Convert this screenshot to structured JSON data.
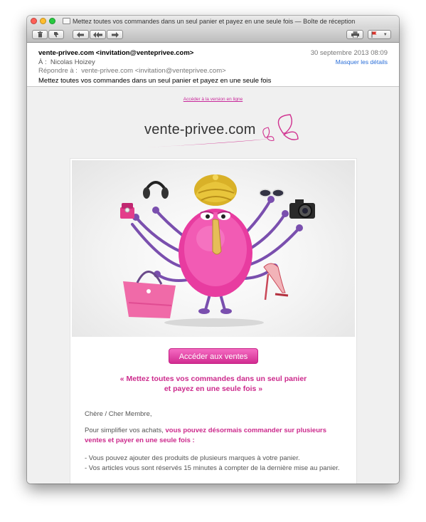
{
  "window": {
    "title": "Mettez toutes vos commandes dans un seul panier et payez en une seule fois — Boîte de réception"
  },
  "toolbar": {
    "buttons": [
      "trash-icon",
      "junk-icon",
      "reply-icon",
      "reply-all-icon",
      "forward-icon",
      "print-icon",
      "flag-icon"
    ]
  },
  "header": {
    "from": "vente-privee.com <invitation@venteprivee.com>",
    "date": "30 septembre 2013 08:09",
    "hide_details": "Masquer les détails",
    "to_label": "À :",
    "to_value": "Nicolas Hoizey",
    "reply_label": "Répondre à :",
    "reply_value": "vente-privee.com <invitation@venteprivee.com>",
    "subject": "Mettez toutes vos commandes dans un seul panier et payez en une seule fois"
  },
  "email": {
    "online_link": "Accéder à la version en ligne",
    "logo_text": "vente-privee.com",
    "cta": "Accéder aux ventes",
    "slogan_line1": "« Mettez toutes vos commandes dans un seul panier",
    "slogan_line2": "et payez en une seule fois »",
    "greeting": "Chère / Cher Membre,",
    "intro_plain": "Pour simplifier vos achats, ",
    "intro_bold": "vous pouvez désormais commander sur plusieurs ventes et payer en une seule fois :",
    "bullet1": "- Vous pouvez ajouter des produits de plusieurs marques à votre panier.",
    "bullet2": "- Vos articles vous sont réservés 15 minutes à compter de la dernière mise au panier."
  },
  "colors": {
    "brand_pink": "#cc2a8c",
    "link_blue": "#2a6ed8"
  }
}
